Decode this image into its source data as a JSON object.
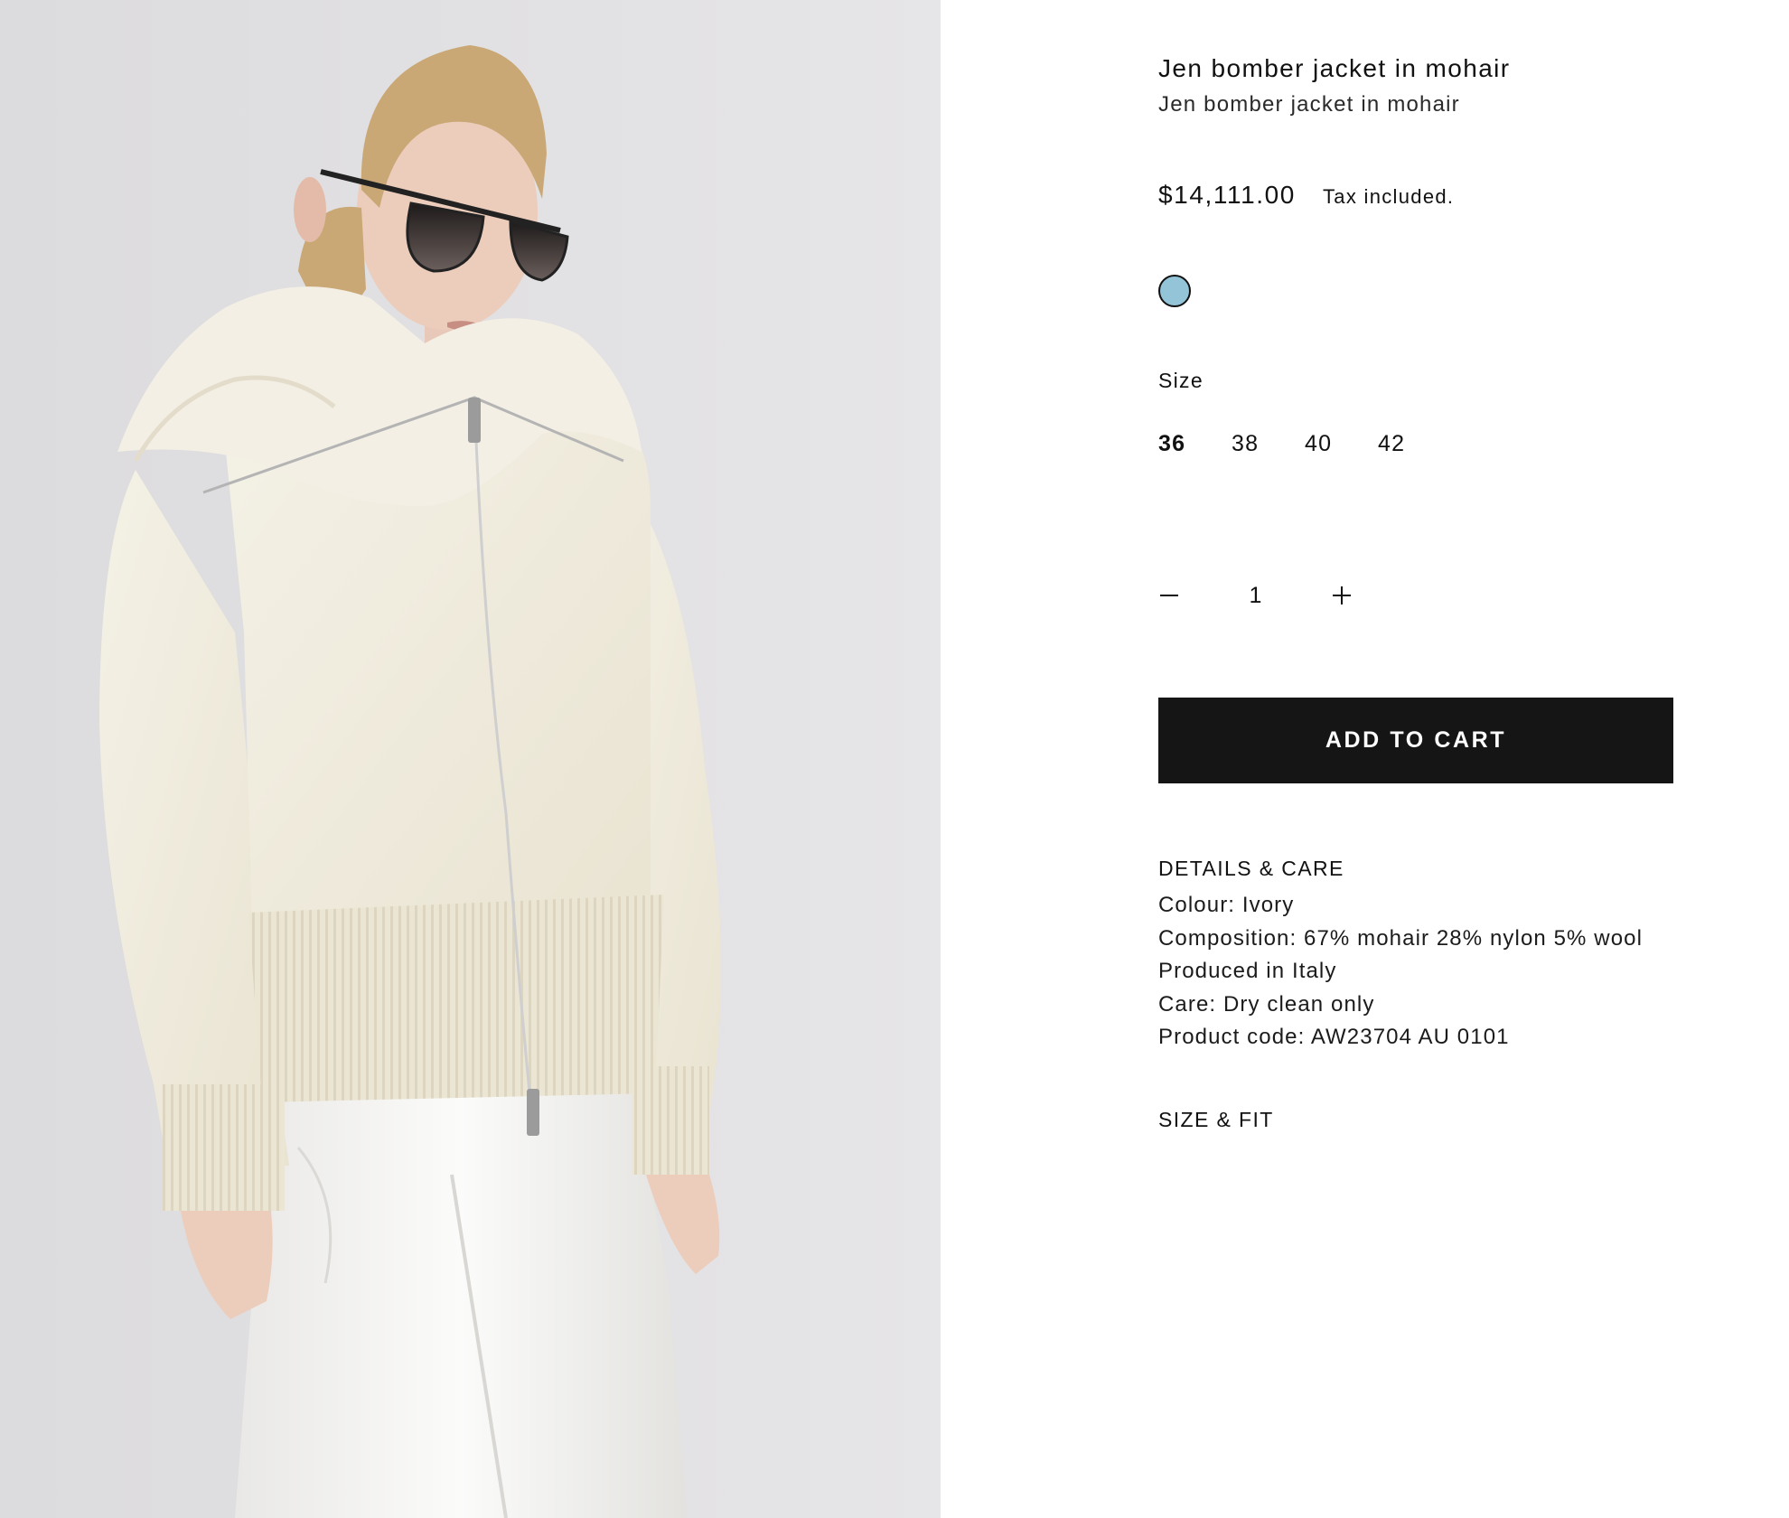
{
  "product": {
    "title": "Jen bomber jacket in mohair",
    "subtitle": "Jen bomber jacket in mohair",
    "price": "$14,111.00",
    "tax_note": "Tax included.",
    "image_name": "product-photo"
  },
  "colour": {
    "swatch_color": "#94c4d8"
  },
  "size": {
    "label": "Size",
    "options": [
      "36",
      "38",
      "40",
      "42"
    ],
    "selected": "36"
  },
  "quantity": {
    "value": "1"
  },
  "cart": {
    "add_label": "ADD TO CART"
  },
  "details": {
    "heading": "DETAILS & CARE",
    "lines": [
      "Colour: Ivory",
      "Composition: 67% mohair 28% nylon 5% wool",
      "Produced in Italy",
      "Care: Dry clean only",
      "Product code: AW23704 AU 0101"
    ]
  },
  "size_fit": {
    "heading": "SIZE & FIT"
  },
  "colors": {
    "button_bg": "#151515",
    "photo_bg": "#e2e1e3",
    "garment": "#f1ede0"
  }
}
